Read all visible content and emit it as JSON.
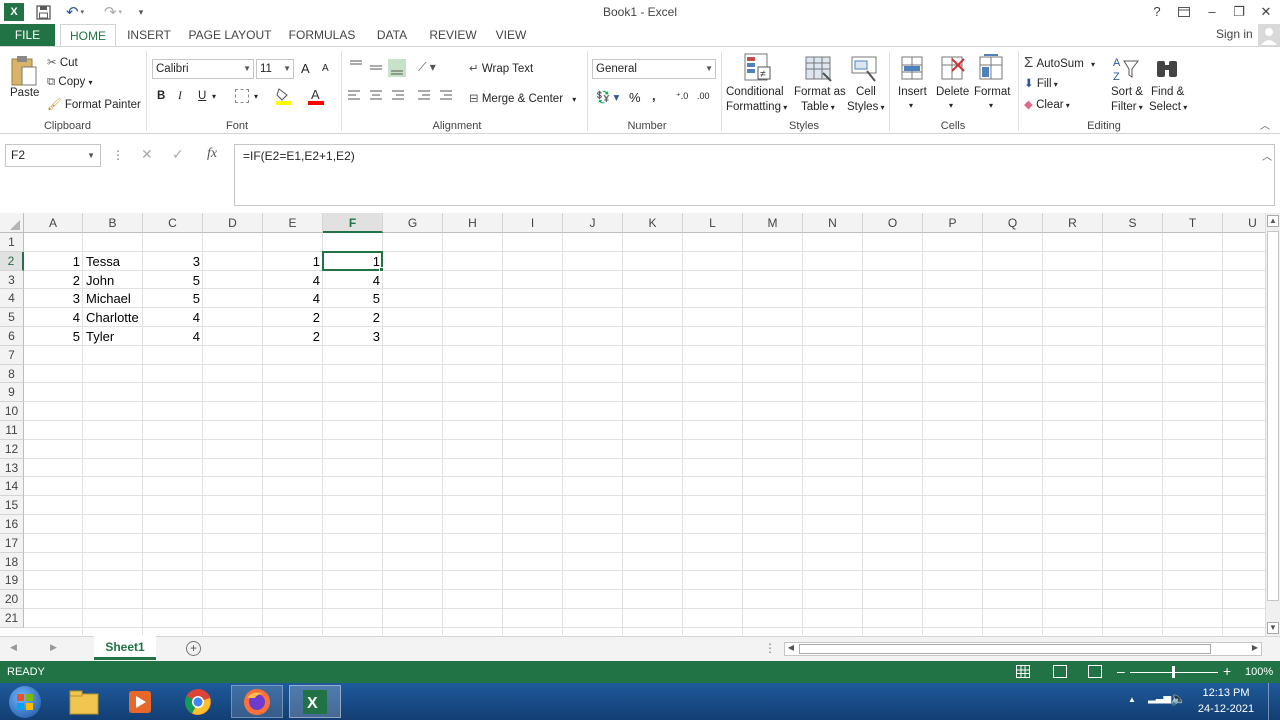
{
  "window": {
    "title": "Book1 - Excel",
    "help": "?",
    "minimize": "–",
    "restore": "❐",
    "close": "✕"
  },
  "qat": {
    "save": "💾",
    "undo": "↶",
    "redo": "↷"
  },
  "tabs": [
    {
      "label": "FILE"
    },
    {
      "label": "HOME"
    },
    {
      "label": "INSERT"
    },
    {
      "label": "PAGE LAYOUT"
    },
    {
      "label": "FORMULAS"
    },
    {
      "label": "DATA"
    },
    {
      "label": "REVIEW"
    },
    {
      "label": "VIEW"
    }
  ],
  "sign_in": "Sign in",
  "ribbon": {
    "clipboard": {
      "paste": "Paste",
      "cut": "Cut",
      "copy": "Copy",
      "format_painter": "Format Painter",
      "label": "Clipboard"
    },
    "font": {
      "name": "Calibri",
      "size": "11",
      "bold": "B",
      "italic": "I",
      "underline": "U",
      "grow": "A",
      "shrink": "A",
      "label": "Font"
    },
    "alignment": {
      "wrap_text": "Wrap Text",
      "merge_center": "Merge & Center",
      "label": "Alignment"
    },
    "number": {
      "format": "General",
      "percent": "%",
      "comma": ",",
      "label": "Number"
    },
    "styles": {
      "conditional": "Conditional",
      "conditional2": "Formatting",
      "format_as": "Format as",
      "format_as2": "Table",
      "cell": "Cell",
      "cell2": "Styles",
      "label": "Styles"
    },
    "cells": {
      "insert": "Insert",
      "delete": "Delete",
      "format": "Format",
      "label": "Cells"
    },
    "editing": {
      "autosum": "AutoSum",
      "fill": "Fill",
      "clear": "Clear",
      "sort": "Sort &",
      "sort2": "Filter",
      "find": "Find &",
      "find2": "Select",
      "label": "Editing"
    }
  },
  "formula_bar": {
    "name_box": "F2",
    "formula": "=IF(E2=E1,E2+1,E2)",
    "fx": "fx"
  },
  "columns": [
    "A",
    "B",
    "C",
    "D",
    "E",
    "F",
    "G",
    "H",
    "I",
    "J",
    "K",
    "L",
    "M",
    "N",
    "O",
    "P",
    "Q",
    "R",
    "S",
    "T",
    "U"
  ],
  "rows": [
    "1",
    "2",
    "3",
    "4",
    "5",
    "6",
    "7",
    "8",
    "9",
    "10",
    "11",
    "12",
    "13",
    "14",
    "15",
    "16",
    "17",
    "18",
    "19",
    "20",
    "21"
  ],
  "cells": [
    {
      "ref": "A2",
      "value": "1"
    },
    {
      "ref": "B2",
      "value": "Tessa"
    },
    {
      "ref": "C2",
      "value": "3"
    },
    {
      "ref": "E2",
      "value": "1"
    },
    {
      "ref": "F2",
      "value": "1"
    },
    {
      "ref": "A3",
      "value": "2"
    },
    {
      "ref": "B3",
      "value": "John"
    },
    {
      "ref": "C3",
      "value": "5"
    },
    {
      "ref": "E3",
      "value": "4"
    },
    {
      "ref": "F3",
      "value": "4"
    },
    {
      "ref": "A4",
      "value": "3"
    },
    {
      "ref": "B4",
      "value": "Michael"
    },
    {
      "ref": "C4",
      "value": "5"
    },
    {
      "ref": "E4",
      "value": "4"
    },
    {
      "ref": "F4",
      "value": "5"
    },
    {
      "ref": "A5",
      "value": "4"
    },
    {
      "ref": "B5",
      "value": "Charlotte"
    },
    {
      "ref": "C5",
      "value": "4"
    },
    {
      "ref": "E5",
      "value": "2"
    },
    {
      "ref": "F5",
      "value": "2"
    },
    {
      "ref": "A6",
      "value": "5"
    },
    {
      "ref": "B6",
      "value": "Tyler"
    },
    {
      "ref": "C6",
      "value": "4"
    },
    {
      "ref": "E6",
      "value": "2"
    },
    {
      "ref": "F6",
      "value": "3"
    }
  ],
  "selected_cell": "F2",
  "sheet_tabs": [
    {
      "label": "Sheet1"
    }
  ],
  "status": {
    "ready": "READY",
    "zoom": "100%"
  },
  "taskbar": {
    "time": "12:13 PM",
    "date": "24-12-2021"
  },
  "colors": {
    "accent": "#217346",
    "taskbar": "#1e5a9b"
  }
}
